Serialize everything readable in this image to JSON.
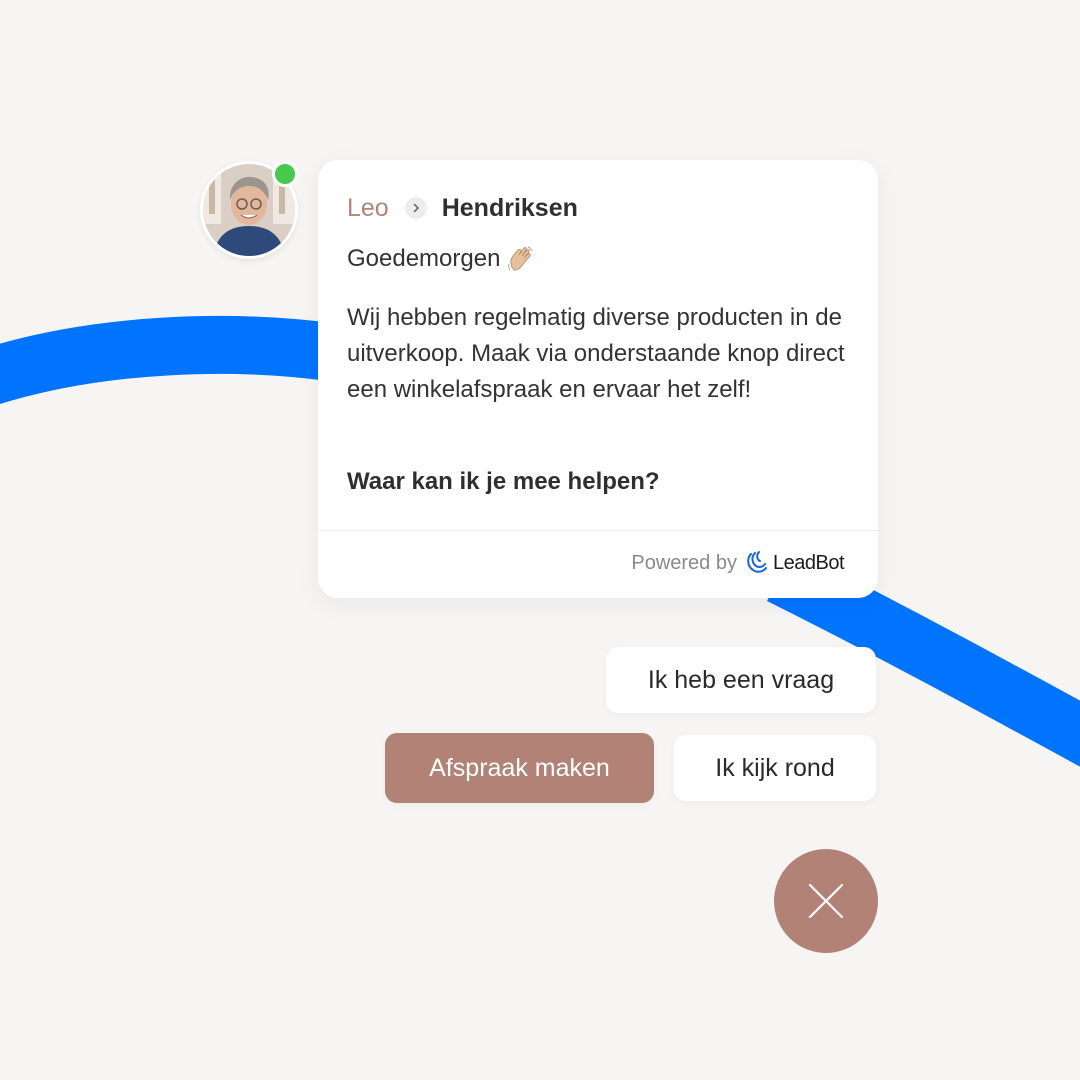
{
  "colors": {
    "background": "#f7f5f3",
    "accent": "#b28276",
    "curve": "#0074ff",
    "online": "#46c94c"
  },
  "agent": {
    "first_name": "Leo",
    "last_name": "Hendriksen",
    "status": "online"
  },
  "chat": {
    "greeting": "Goedemorgen",
    "message": "Wij hebben regelmatig diverse producten in de uitverkoop. Maak via onderstaande knop direct een winkelafspraak en ervaar het zelf!",
    "question": "Waar kan ik je mee helpen?",
    "powered_by": "Powered by",
    "brand": "LeadBot"
  },
  "replies": {
    "question": "Ik heb een vraag",
    "appointment": "Afspraak maken",
    "look_around": "Ik kijk rond"
  },
  "icons": {
    "header_separator": "chevron-right-icon",
    "greeting_emoji": "waving-hand-icon",
    "close": "close-icon",
    "brand_logo": "leadbot-logo-icon"
  }
}
